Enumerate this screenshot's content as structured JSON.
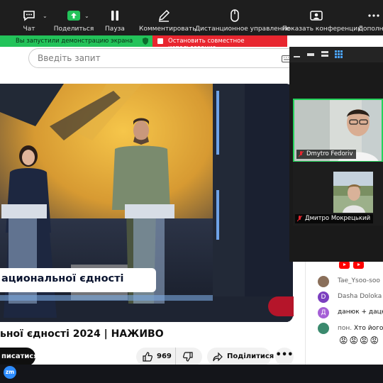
{
  "zoom_toolbar": {
    "items": [
      {
        "label": "Чат",
        "icon": "chat-icon"
      },
      {
        "label": "Поделиться",
        "icon": "share-screen-icon"
      },
      {
        "label": "Пауза",
        "icon": "pause-icon"
      },
      {
        "label": "Комментировать",
        "icon": "pencil-icon"
      },
      {
        "label": "Дистанционное управление",
        "icon": "mouse-icon"
      },
      {
        "label": "Показать конференцию",
        "icon": "show-meeting-icon"
      },
      {
        "label": "Дополн",
        "icon": "more-icon"
      }
    ]
  },
  "share_bar": {
    "status": "Вы запустили демонстрацию экрана",
    "stop": "Остановить совместное использование"
  },
  "youtube": {
    "search_placeholder": "Введіть запит",
    "chyron": "ационaльної єдності",
    "title": "ьної єдності 2024 | НАЖИВО",
    "subscribe": "писатися",
    "likes": "969",
    "share": "Поділитися",
    "more": "•••"
  },
  "participants": [
    {
      "name": "Dmytro Fedoriv",
      "active": true
    },
    {
      "name": "Дмитро Мокрецький",
      "active": false
    }
  ],
  "chat": [
    {
      "initial": "",
      "author": "Tae_Ysoo-soo",
      "text": "",
      "color": "#8a6f5a"
    },
    {
      "initial": "D",
      "author": "Dasha Doloka",
      "text": "",
      "color": "#7b3fbf"
    },
    {
      "initial": "Д",
      "author": "",
      "text": "данюк + дацко",
      "color": "#a55fd6"
    },
    {
      "initial": "",
      "author": "пон.",
      "text": "Хто його",
      "color": "#3b8a6e"
    }
  ],
  "chat_emojis": "😡😡😡😡",
  "taskbar": {
    "zoom_label": "zm"
  },
  "colors": {
    "zoom_toolbar": "#1e1e1e",
    "share_green": "#23c35a",
    "share_red": "#e8262f",
    "active_speaker": "#24d25a",
    "youtube_red": "#ff0000"
  }
}
